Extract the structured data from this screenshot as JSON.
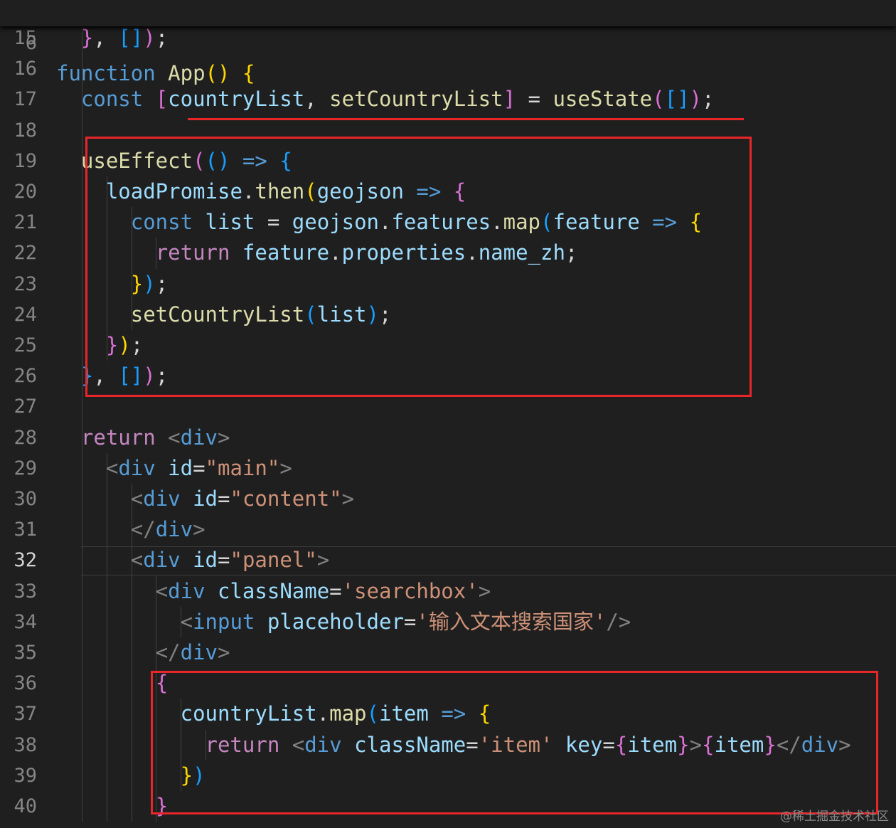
{
  "colors": {
    "background": "#1f1f1f",
    "keyword": "#569cd6",
    "control": "#c586c0",
    "function": "#dcdcaa",
    "variable": "#9cdcfe",
    "string": "#ce9178",
    "punctuation": "#d4d4d4",
    "tag_bracket": "#808080",
    "bracket_gold": "#ffd700",
    "bracket_pink": "#da70d6",
    "bracket_blue": "#179fff",
    "annotation": "#e8262a"
  },
  "sticky": {
    "number": "6",
    "tokens": [
      [
        "function",
        "keyword"
      ],
      [
        " ",
        "punctuation"
      ],
      [
        "App",
        "function"
      ],
      [
        "()",
        "bracket_gold"
      ],
      [
        " ",
        "punctuation"
      ],
      [
        "{",
        "bracket_gold"
      ]
    ]
  },
  "active_line": "32",
  "lines": [
    {
      "number": "15",
      "tokens": [
        [
          "  ",
          "punctuation"
        ],
        [
          "}",
          "bracket_pink"
        ],
        [
          ", ",
          "punctuation"
        ],
        [
          "[]",
          "bracket_blue"
        ],
        [
          ")",
          "bracket_pink"
        ],
        [
          ";",
          "punctuation"
        ]
      ]
    },
    {
      "number": "16",
      "tokens": []
    },
    {
      "number": "17",
      "tokens": [
        [
          "  ",
          "punctuation"
        ],
        [
          "const",
          "keyword"
        ],
        [
          " ",
          "punctuation"
        ],
        [
          "[",
          "bracket_pink"
        ],
        [
          "countryList",
          "variable"
        ],
        [
          ", ",
          "punctuation"
        ],
        [
          "setCountryList",
          "function"
        ],
        [
          "]",
          "bracket_pink"
        ],
        [
          " = ",
          "punctuation"
        ],
        [
          "useState",
          "function"
        ],
        [
          "(",
          "bracket_pink"
        ],
        [
          "[]",
          "bracket_blue"
        ],
        [
          ")",
          "bracket_pink"
        ],
        [
          ";",
          "punctuation"
        ]
      ]
    },
    {
      "number": "18",
      "tokens": []
    },
    {
      "number": "19",
      "tokens": [
        [
          "  ",
          "punctuation"
        ],
        [
          "useEffect",
          "function"
        ],
        [
          "(",
          "bracket_pink"
        ],
        [
          "()",
          "bracket_blue"
        ],
        [
          " ",
          "punctuation"
        ],
        [
          "=>",
          "keyword"
        ],
        [
          " ",
          "punctuation"
        ],
        [
          "{",
          "bracket_blue"
        ]
      ]
    },
    {
      "number": "20",
      "tokens": [
        [
          "    ",
          "punctuation"
        ],
        [
          "loadPromise",
          "variable"
        ],
        [
          ".",
          "punctuation"
        ],
        [
          "then",
          "function"
        ],
        [
          "(",
          "bracket_gold"
        ],
        [
          "geojson",
          "variable"
        ],
        [
          " ",
          "punctuation"
        ],
        [
          "=>",
          "keyword"
        ],
        [
          " ",
          "punctuation"
        ],
        [
          "{",
          "bracket_pink"
        ]
      ]
    },
    {
      "number": "21",
      "tokens": [
        [
          "      ",
          "punctuation"
        ],
        [
          "const",
          "keyword"
        ],
        [
          " ",
          "punctuation"
        ],
        [
          "list",
          "variable"
        ],
        [
          " = ",
          "punctuation"
        ],
        [
          "geojson",
          "variable"
        ],
        [
          ".",
          "punctuation"
        ],
        [
          "features",
          "variable"
        ],
        [
          ".",
          "punctuation"
        ],
        [
          "map",
          "function"
        ],
        [
          "(",
          "bracket_blue"
        ],
        [
          "feature",
          "variable"
        ],
        [
          " ",
          "punctuation"
        ],
        [
          "=>",
          "keyword"
        ],
        [
          " ",
          "punctuation"
        ],
        [
          "{",
          "bracket_gold"
        ]
      ]
    },
    {
      "number": "22",
      "tokens": [
        [
          "        ",
          "punctuation"
        ],
        [
          "return",
          "control"
        ],
        [
          " ",
          "punctuation"
        ],
        [
          "feature",
          "variable"
        ],
        [
          ".",
          "punctuation"
        ],
        [
          "properties",
          "variable"
        ],
        [
          ".",
          "punctuation"
        ],
        [
          "name_zh",
          "variable"
        ],
        [
          ";",
          "punctuation"
        ]
      ]
    },
    {
      "number": "23",
      "tokens": [
        [
          "      ",
          "punctuation"
        ],
        [
          "}",
          "bracket_gold"
        ],
        [
          ")",
          "bracket_blue"
        ],
        [
          ";",
          "punctuation"
        ]
      ]
    },
    {
      "number": "24",
      "tokens": [
        [
          "      ",
          "punctuation"
        ],
        [
          "setCountryList",
          "function"
        ],
        [
          "(",
          "bracket_blue"
        ],
        [
          "list",
          "variable"
        ],
        [
          ")",
          "bracket_blue"
        ],
        [
          ";",
          "punctuation"
        ]
      ]
    },
    {
      "number": "25",
      "tokens": [
        [
          "    ",
          "punctuation"
        ],
        [
          "}",
          "bracket_pink"
        ],
        [
          ")",
          "bracket_gold"
        ],
        [
          ";",
          "punctuation"
        ]
      ]
    },
    {
      "number": "26",
      "tokens": [
        [
          "  ",
          "punctuation"
        ],
        [
          "}",
          "bracket_blue"
        ],
        [
          ", ",
          "punctuation"
        ],
        [
          "[]",
          "bracket_blue"
        ],
        [
          ")",
          "bracket_pink"
        ],
        [
          ";",
          "punctuation"
        ]
      ]
    },
    {
      "number": "27",
      "tokens": []
    },
    {
      "number": "28",
      "tokens": [
        [
          "  ",
          "punctuation"
        ],
        [
          "return",
          "control"
        ],
        [
          " ",
          "punctuation"
        ],
        [
          "<",
          "tag_bracket"
        ],
        [
          "div",
          "keyword"
        ],
        [
          ">",
          "tag_bracket"
        ]
      ]
    },
    {
      "number": "29",
      "tokens": [
        [
          "    ",
          "punctuation"
        ],
        [
          "<",
          "tag_bracket"
        ],
        [
          "div",
          "keyword"
        ],
        [
          " ",
          "punctuation"
        ],
        [
          "id",
          "variable"
        ],
        [
          "=",
          "punctuation"
        ],
        [
          "\"main\"",
          "string"
        ],
        [
          ">",
          "tag_bracket"
        ]
      ]
    },
    {
      "number": "30",
      "tokens": [
        [
          "      ",
          "punctuation"
        ],
        [
          "<",
          "tag_bracket"
        ],
        [
          "div",
          "keyword"
        ],
        [
          " ",
          "punctuation"
        ],
        [
          "id",
          "variable"
        ],
        [
          "=",
          "punctuation"
        ],
        [
          "\"content\"",
          "string"
        ],
        [
          ">",
          "tag_bracket"
        ]
      ]
    },
    {
      "number": "31",
      "tokens": [
        [
          "      ",
          "punctuation"
        ],
        [
          "</",
          "tag_bracket"
        ],
        [
          "div",
          "keyword"
        ],
        [
          ">",
          "tag_bracket"
        ]
      ]
    },
    {
      "number": "32",
      "tokens": [
        [
          "      ",
          "punctuation"
        ],
        [
          "<",
          "tag_bracket"
        ],
        [
          "div",
          "keyword"
        ],
        [
          " ",
          "punctuation"
        ],
        [
          "id",
          "variable"
        ],
        [
          "=",
          "punctuation"
        ],
        [
          "\"panel\"",
          "string"
        ],
        [
          ">",
          "tag_bracket"
        ]
      ]
    },
    {
      "number": "33",
      "tokens": [
        [
          "        ",
          "punctuation"
        ],
        [
          "<",
          "tag_bracket"
        ],
        [
          "div",
          "keyword"
        ],
        [
          " ",
          "punctuation"
        ],
        [
          "className",
          "variable"
        ],
        [
          "=",
          "punctuation"
        ],
        [
          "'searchbox'",
          "string"
        ],
        [
          ">",
          "tag_bracket"
        ]
      ]
    },
    {
      "number": "34",
      "tokens": [
        [
          "          ",
          "punctuation"
        ],
        [
          "<",
          "tag_bracket"
        ],
        [
          "input",
          "keyword"
        ],
        [
          " ",
          "punctuation"
        ],
        [
          "placeholder",
          "variable"
        ],
        [
          "=",
          "punctuation"
        ],
        [
          "'输入文本搜索国家'",
          "string"
        ],
        [
          "/>",
          "tag_bracket"
        ]
      ]
    },
    {
      "number": "35",
      "tokens": [
        [
          "        ",
          "punctuation"
        ],
        [
          "</",
          "tag_bracket"
        ],
        [
          "div",
          "keyword"
        ],
        [
          ">",
          "tag_bracket"
        ]
      ]
    },
    {
      "number": "36",
      "tokens": [
        [
          "        ",
          "punctuation"
        ],
        [
          "{",
          "bracket_pink"
        ]
      ]
    },
    {
      "number": "37",
      "tokens": [
        [
          "          ",
          "punctuation"
        ],
        [
          "countryList",
          "variable"
        ],
        [
          ".",
          "punctuation"
        ],
        [
          "map",
          "function"
        ],
        [
          "(",
          "bracket_blue"
        ],
        [
          "item",
          "variable"
        ],
        [
          " ",
          "punctuation"
        ],
        [
          "=>",
          "keyword"
        ],
        [
          " ",
          "punctuation"
        ],
        [
          "{",
          "bracket_gold"
        ]
      ]
    },
    {
      "number": "38",
      "tokens": [
        [
          "            ",
          "punctuation"
        ],
        [
          "return",
          "control"
        ],
        [
          " ",
          "punctuation"
        ],
        [
          "<",
          "tag_bracket"
        ],
        [
          "div",
          "keyword"
        ],
        [
          " ",
          "punctuation"
        ],
        [
          "className",
          "variable"
        ],
        [
          "=",
          "punctuation"
        ],
        [
          "'item'",
          "string"
        ],
        [
          " ",
          "punctuation"
        ],
        [
          "key",
          "variable"
        ],
        [
          "=",
          "punctuation"
        ],
        [
          "{",
          "bracket_pink"
        ],
        [
          "item",
          "variable"
        ],
        [
          "}",
          "bracket_pink"
        ],
        [
          ">",
          "tag_bracket"
        ],
        [
          "{",
          "bracket_pink"
        ],
        [
          "item",
          "variable"
        ],
        [
          "}",
          "bracket_pink"
        ],
        [
          "</",
          "tag_bracket"
        ],
        [
          "div",
          "keyword"
        ],
        [
          ">",
          "tag_bracket"
        ]
      ]
    },
    {
      "number": "39",
      "tokens": [
        [
          "          ",
          "punctuation"
        ],
        [
          "}",
          "bracket_gold"
        ],
        [
          ")",
          "bracket_blue"
        ]
      ]
    },
    {
      "number": "40",
      "tokens": [
        [
          "        ",
          "punctuation"
        ],
        [
          "}",
          "bracket_pink"
        ]
      ]
    }
  ],
  "watermark": "@稀土掘金技术社区"
}
